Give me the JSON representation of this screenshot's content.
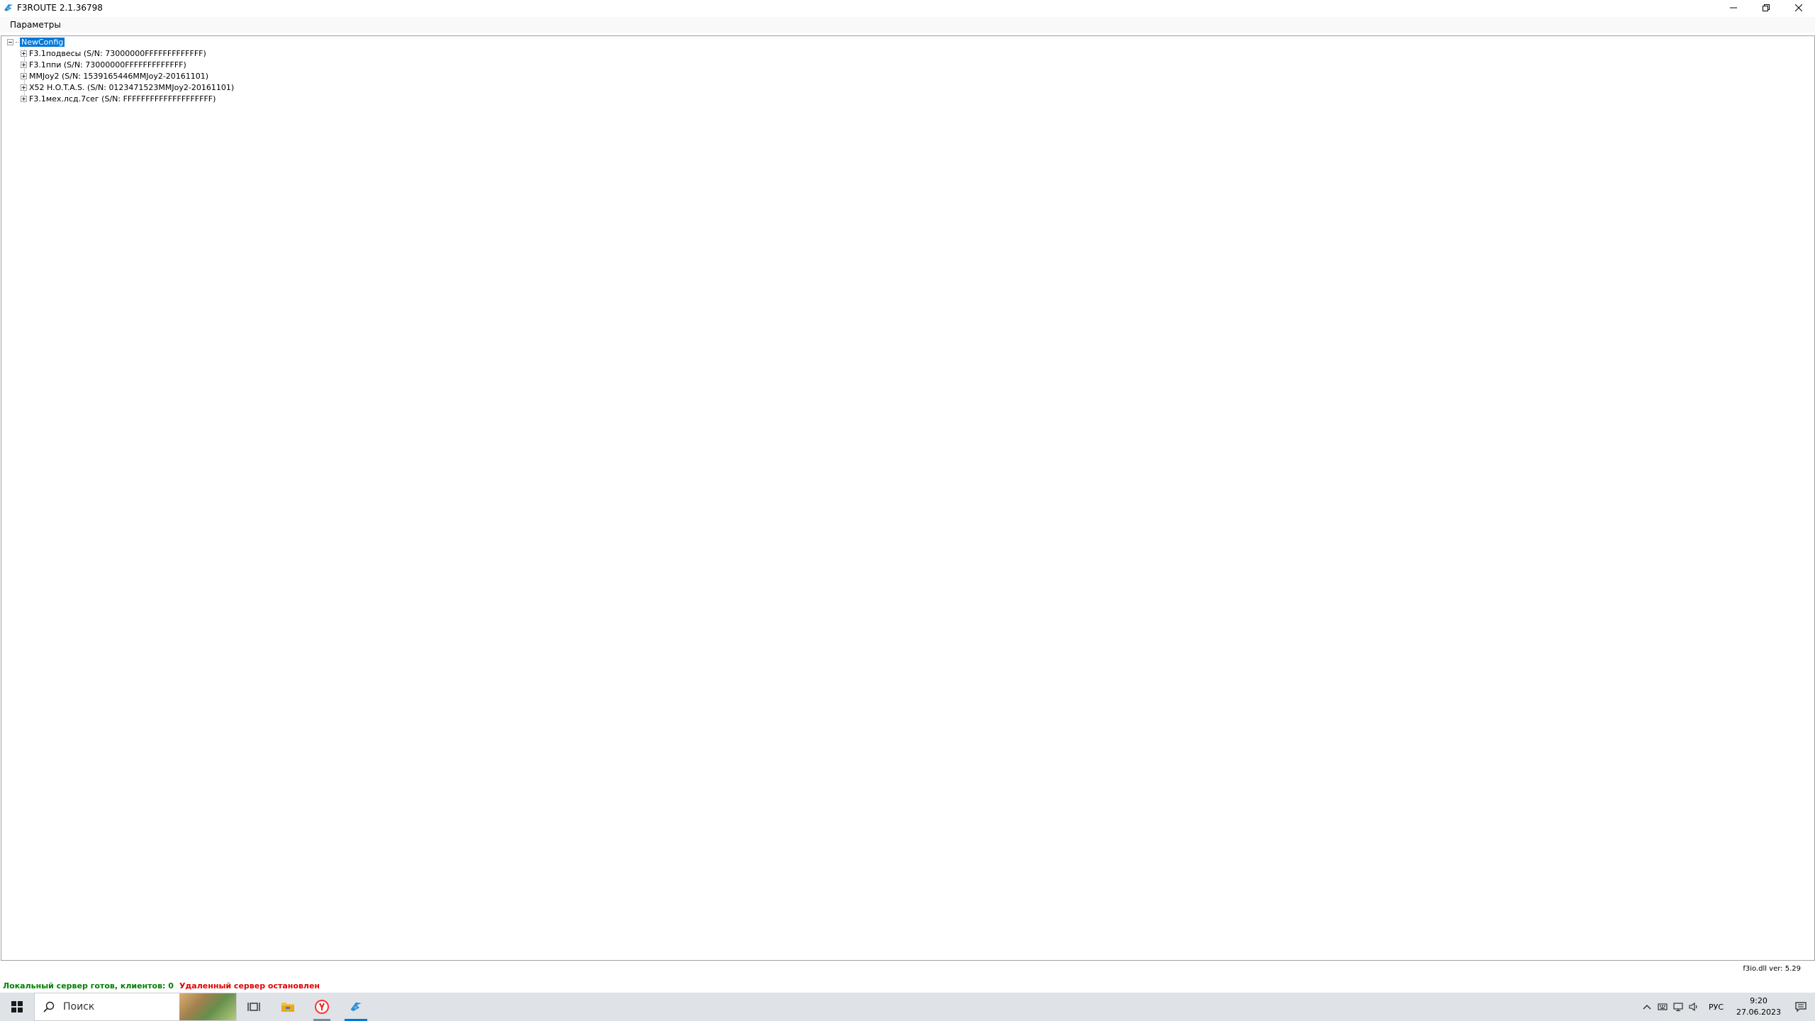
{
  "window": {
    "title": "F3ROUTE 2.1.36798",
    "icon": "f3route-app-icon",
    "controls": [
      "minimize-icon",
      "restore-icon",
      "close-icon"
    ]
  },
  "menu": {
    "items": [
      {
        "label": "Параметры"
      }
    ]
  },
  "tree": {
    "root": {
      "label": "NewConfig",
      "expanded": true,
      "selected": true
    },
    "children": [
      {
        "label": "F3.1подвесы (S/N: 73000000FFFFFFFFFFFFF)"
      },
      {
        "label": "F3.1ппи (S/N: 73000000FFFFFFFFFFFFF)"
      },
      {
        "label": "MMJoy2 (S/N: 1539165446MMJoy2-20161101)"
      },
      {
        "label": "X52 H.O.T.A.S. (S/N: 0123471523MMJoy2-20161101)"
      },
      {
        "label": "F3.1мех.лсд.7сег (S/N: FFFFFFFFFFFFFFFFFFFF)"
      }
    ]
  },
  "footer": {
    "dll_version": "f3io.dll ver: 5.29",
    "local_status": "Локальный сервер готов, клиентов: 0",
    "remote_status": "Удаленный сервер остановлен",
    "local_color": "#008000",
    "remote_color": "#e00000"
  },
  "taskbar": {
    "search_placeholder": "Поиск",
    "apps": [
      "windows-start-icon",
      "task-view-icon",
      "file-explorer-icon",
      "yandex-browser-icon",
      "f3route-app-icon"
    ],
    "tray": {
      "icons": [
        "chevron-up-icon",
        "keyboard-icon",
        "network-icon",
        "volume-icon"
      ],
      "language": "РУС",
      "time": "9:20",
      "date": "27.06.2023"
    }
  }
}
